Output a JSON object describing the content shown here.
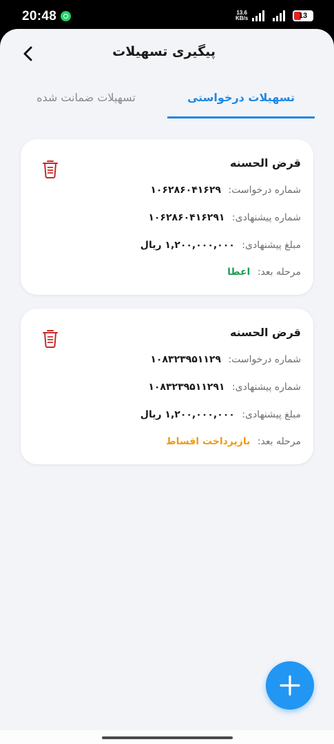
{
  "status_bar": {
    "time": "20:48",
    "net_speed_value": "13.6",
    "net_speed_unit": "KB/s",
    "battery_level": "13"
  },
  "header": {
    "title": "پیگیری تسهیلات"
  },
  "tabs": [
    {
      "label": "تسهیلات درخواستی"
    },
    {
      "label": "تسهیلات ضمانت شده"
    }
  ],
  "labels": {
    "request_number": "شماره درخواست:",
    "proposal_number": "شماره پیشنهادی:",
    "proposed_amount": "مبلغ پیشنهادی:",
    "next_stage": "مرحله بعد:"
  },
  "cards": [
    {
      "title": "قرض الحسنه",
      "request_number": "۱۰۶۲۸۶۰۴۱۶۲۹",
      "proposal_number": "۱۰۶۲۸۶۰۴۱۶۲۹۱",
      "proposed_amount": "۱,۲۰۰,۰۰۰,۰۰۰ ریال",
      "next_stage": "اعطا"
    },
    {
      "title": "قرض الحسنه",
      "request_number": "۱۰۸۳۲۳۹۵۱۱۲۹",
      "proposal_number": "۱۰۸۳۲۳۹۵۱۱۲۹۱",
      "proposed_amount": "۱,۲۰۰,۰۰۰,۰۰۰ ریال",
      "next_stage": "بازپرداخت اقساط"
    }
  ],
  "colors": {
    "accent": "#1e88e5",
    "fab": "#2196f3",
    "stage_grant": "#1f9d55",
    "stage_repayment": "#f09a12",
    "delete_icon": "#c62828"
  },
  "icons": {
    "back": "chevron-left-icon",
    "delete": "trash-icon",
    "add": "plus-icon"
  }
}
